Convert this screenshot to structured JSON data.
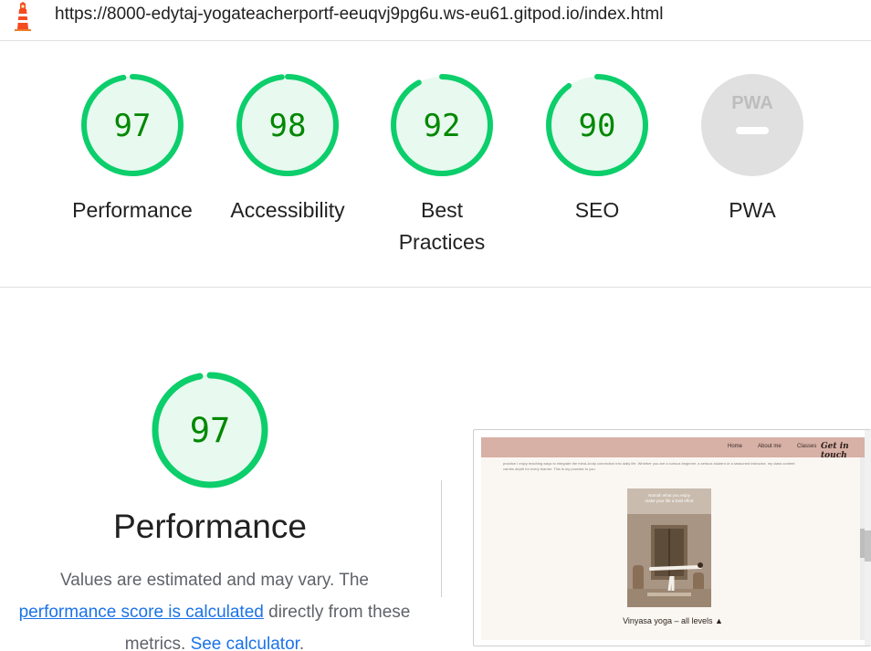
{
  "header": {
    "url": "https://8000-edytaj-yogateacherportf-eeuqvj9pg6u.ws-eu61.gitpod.io/index.html",
    "logo_icon": "lighthouse-icon"
  },
  "colors": {
    "pass_ring": "#0cce6b",
    "pass_fill": "#e8f9ef",
    "pass_text": "#008800",
    "na_fill": "#e0e0e0",
    "link": "#1a73e8"
  },
  "scores": [
    {
      "label": "Performance",
      "value": 97
    },
    {
      "label": "Accessibility",
      "value": 98
    },
    {
      "label": "Best Practices",
      "label_line1": "Best",
      "label_line2": "Practices",
      "value": 92
    },
    {
      "label": "SEO",
      "value": 90
    },
    {
      "label": "PWA",
      "value": null,
      "badge": "PWA"
    }
  ],
  "performance": {
    "score": 97,
    "title": "Performance",
    "desc_1": "Values are estimated and may vary. The",
    "link_1": "performance score is calculated",
    "desc_2": "directly from these",
    "desc_3": "metrics.",
    "link_2": "See calculator",
    "desc_4": "."
  },
  "screenshot": {
    "nav": [
      "Home",
      "About me",
      "Classes"
    ],
    "cta": "Get in touch",
    "text_1": "practice I enjoy teaching ways to integrate the mind–body connection into daily life. Whether you are a curious beginner, a serious student or a seasoned instructor, my class content",
    "text_2": "carries depth for every learner. This is my promise to you.",
    "img_caption_1": "Namah what you enjoy",
    "img_caption_2": "make your life a bold effort",
    "caption": "Vinyasa yoga – all levels"
  }
}
